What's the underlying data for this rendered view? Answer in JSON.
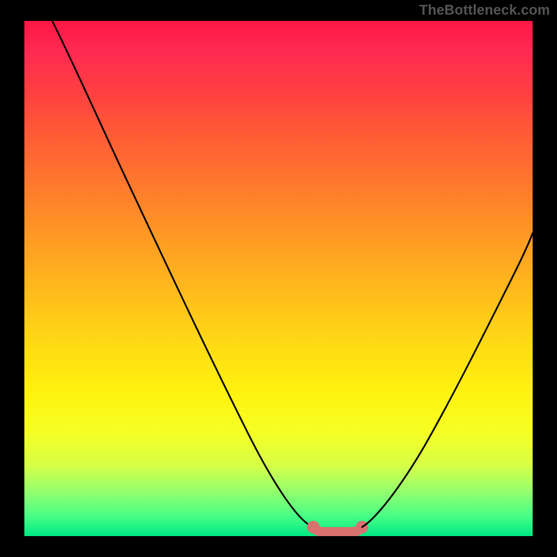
{
  "watermark": "TheBottleneck.com",
  "colors": {
    "frame": "#000000",
    "curve": "#000000",
    "highlight": "#d9716f",
    "gradient_top": "#ff1744",
    "gradient_bottom": "#00e884"
  },
  "chart_data": {
    "type": "line",
    "title": "",
    "xlabel": "",
    "ylabel": "",
    "xlim": [
      0,
      100
    ],
    "ylim": [
      0,
      100
    ],
    "x": [
      0,
      5,
      10,
      15,
      20,
      25,
      30,
      35,
      40,
      45,
      50,
      55,
      58,
      62,
      65,
      70,
      75,
      80,
      85,
      90,
      95,
      100
    ],
    "y": [
      100,
      92,
      83,
      74,
      65,
      56,
      47,
      38,
      29,
      20,
      11,
      4,
      1,
      1,
      3,
      9,
      17,
      26,
      35,
      43,
      51,
      58
    ],
    "highlight_range_x": [
      55,
      65
    ],
    "highlight_y": 1,
    "grid": false,
    "legend": false
  }
}
